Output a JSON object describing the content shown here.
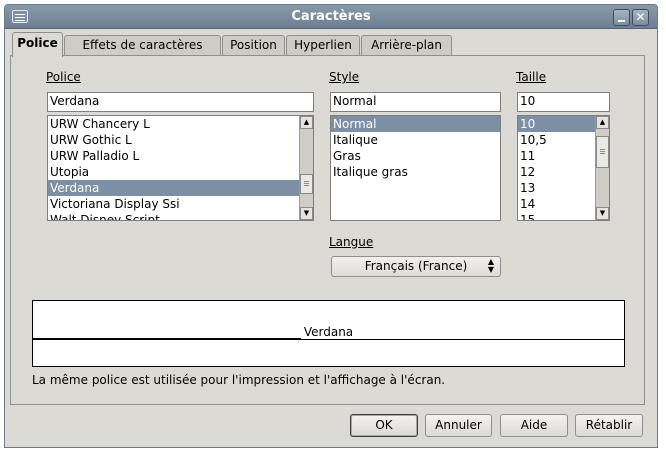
{
  "window": {
    "title": "Caractères"
  },
  "tabs": [
    {
      "label": "Police",
      "active": true
    },
    {
      "label": "Effets de caractères",
      "active": false
    },
    {
      "label": "Position",
      "active": false
    },
    {
      "label": "Hyperlien",
      "active": false
    },
    {
      "label": "Arrière-plan",
      "active": false
    }
  ],
  "font": {
    "label": "Police",
    "value": "Verdana",
    "list": [
      "URW Chancery L",
      "URW Gothic L",
      "URW Palladio L",
      "Utopia",
      "Verdana",
      "Victoriana Display Ssi",
      "Walt Disney Script"
    ],
    "selected_index": 4
  },
  "style": {
    "label": "Style",
    "value": "Normal",
    "list": [
      "Normal",
      "Italique",
      "Gras",
      "Italique gras"
    ],
    "selected_index": 0
  },
  "size": {
    "label": "Taille",
    "value": "10",
    "list": [
      "10",
      "10,5",
      "11",
      "12",
      "13",
      "14",
      "15"
    ],
    "selected_index": 0
  },
  "language": {
    "label": "Langue",
    "value": "Français (France)"
  },
  "preview": {
    "text": "Verdana",
    "note": "La même police est utilisée pour l'impression et l'affichage à l'écran."
  },
  "buttons": {
    "ok": "OK",
    "cancel": "Annuler",
    "help": "Aide",
    "reset": "Rétablir"
  },
  "colors": {
    "titlebar": "#7b8c9d",
    "selection": "#7c8fa4",
    "dialog_bg": "#dcdad5"
  }
}
